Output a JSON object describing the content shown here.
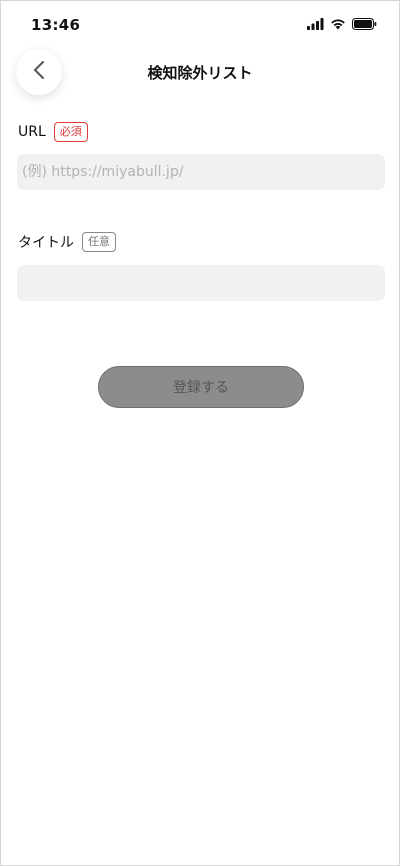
{
  "status_bar": {
    "time": "13:46",
    "icons": [
      "cellular-signal-icon",
      "wifi-icon",
      "battery-icon"
    ]
  },
  "header": {
    "back_icon": "chevron-left-icon",
    "title": "検知除外リスト"
  },
  "form": {
    "url": {
      "label": "URL",
      "badge": "必須",
      "value": "",
      "placeholder": "(例) https://miyabull.jp/"
    },
    "title": {
      "label": "タイトル",
      "badge": "任意",
      "value": "",
      "placeholder": ""
    },
    "submit_label": "登録する"
  },
  "colors": {
    "required_badge": "#e03a3a",
    "input_bg": "#f1f1f1",
    "button_bg": "#8c8c8c"
  }
}
